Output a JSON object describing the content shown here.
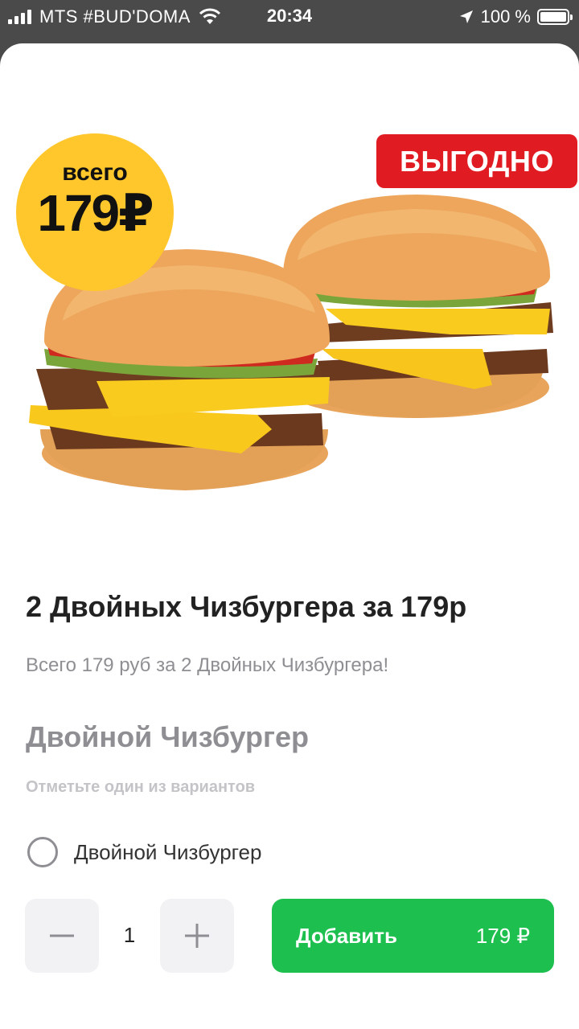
{
  "status_bar": {
    "carrier": "MTS #BUD'DOMA",
    "time": "20:34",
    "battery": "100 %"
  },
  "hero": {
    "price_badge_small": "всего",
    "price_badge_big": "179₽",
    "promo_badge": "ВЫГОДНО"
  },
  "product": {
    "title": "2 Двойных Чизбургера за 179р",
    "description": "Всего 179 руб за 2 Двойных Чизбургера!"
  },
  "options_group": {
    "title": "Двойной Чизбургер",
    "hint": "Отметьте один из вариантов",
    "options": [
      {
        "label": "Двойной Чизбургер",
        "selected": false
      }
    ]
  },
  "cart": {
    "quantity": "1",
    "add_label": "Добавить",
    "add_price": "179 ₽"
  },
  "colors": {
    "accent_green": "#1dbf4e",
    "badge_yellow": "#ffc72c",
    "promo_red": "#e11b22"
  }
}
